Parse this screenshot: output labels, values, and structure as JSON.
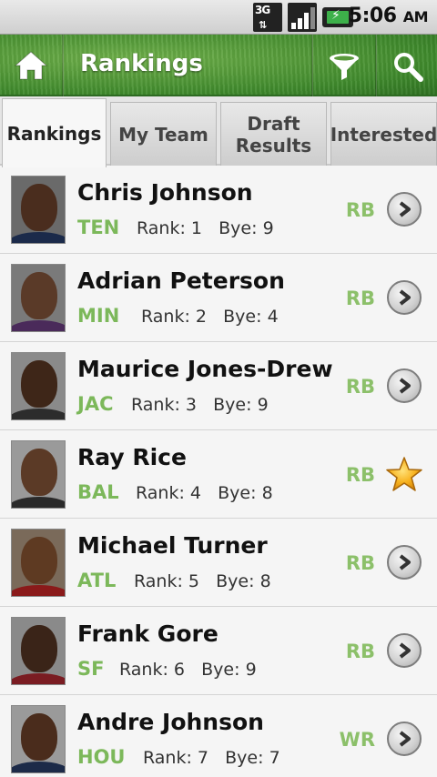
{
  "status_bar": {
    "network": "3G",
    "time": "5:06",
    "ampm": "AM"
  },
  "action_bar": {
    "title": "Rankings",
    "icons": [
      "home-icon",
      "filter-icon",
      "search-icon"
    ]
  },
  "tabs": [
    {
      "label": "Rankings",
      "active": true
    },
    {
      "label": "My Team",
      "active": false
    },
    {
      "label": "Draft Results",
      "active": false
    },
    {
      "label": "Interested",
      "active": false
    }
  ],
  "rank_label": "Rank:",
  "bye_label": "Bye:",
  "players": [
    {
      "name": "Chris Johnson",
      "team": "TEN",
      "rank": "1",
      "bye": "9",
      "position": "RB",
      "action": "chevron"
    },
    {
      "name": "Adrian Peterson",
      "team": "MIN",
      "rank": "2",
      "bye": "4",
      "position": "RB",
      "action": "chevron"
    },
    {
      "name": "Maurice Jones-Drew",
      "team": "JAC",
      "rank": "3",
      "bye": "9",
      "position": "RB",
      "action": "chevron"
    },
    {
      "name": "Ray Rice",
      "team": "BAL",
      "rank": "4",
      "bye": "8",
      "position": "RB",
      "action": "star"
    },
    {
      "name": "Michael Turner",
      "team": "ATL",
      "rank": "5",
      "bye": "8",
      "position": "RB",
      "action": "chevron"
    },
    {
      "name": "Frank Gore",
      "team": "SF",
      "rank": "6",
      "bye": "9",
      "position": "RB",
      "action": "chevron"
    },
    {
      "name": "Andre Johnson",
      "team": "HOU",
      "rank": "7",
      "bye": "7",
      "position": "WR",
      "action": "chevron"
    }
  ],
  "colors": {
    "team_text": "#7cb85a",
    "position_text": "#8cc06a",
    "header_green": "#3f8a2c"
  }
}
